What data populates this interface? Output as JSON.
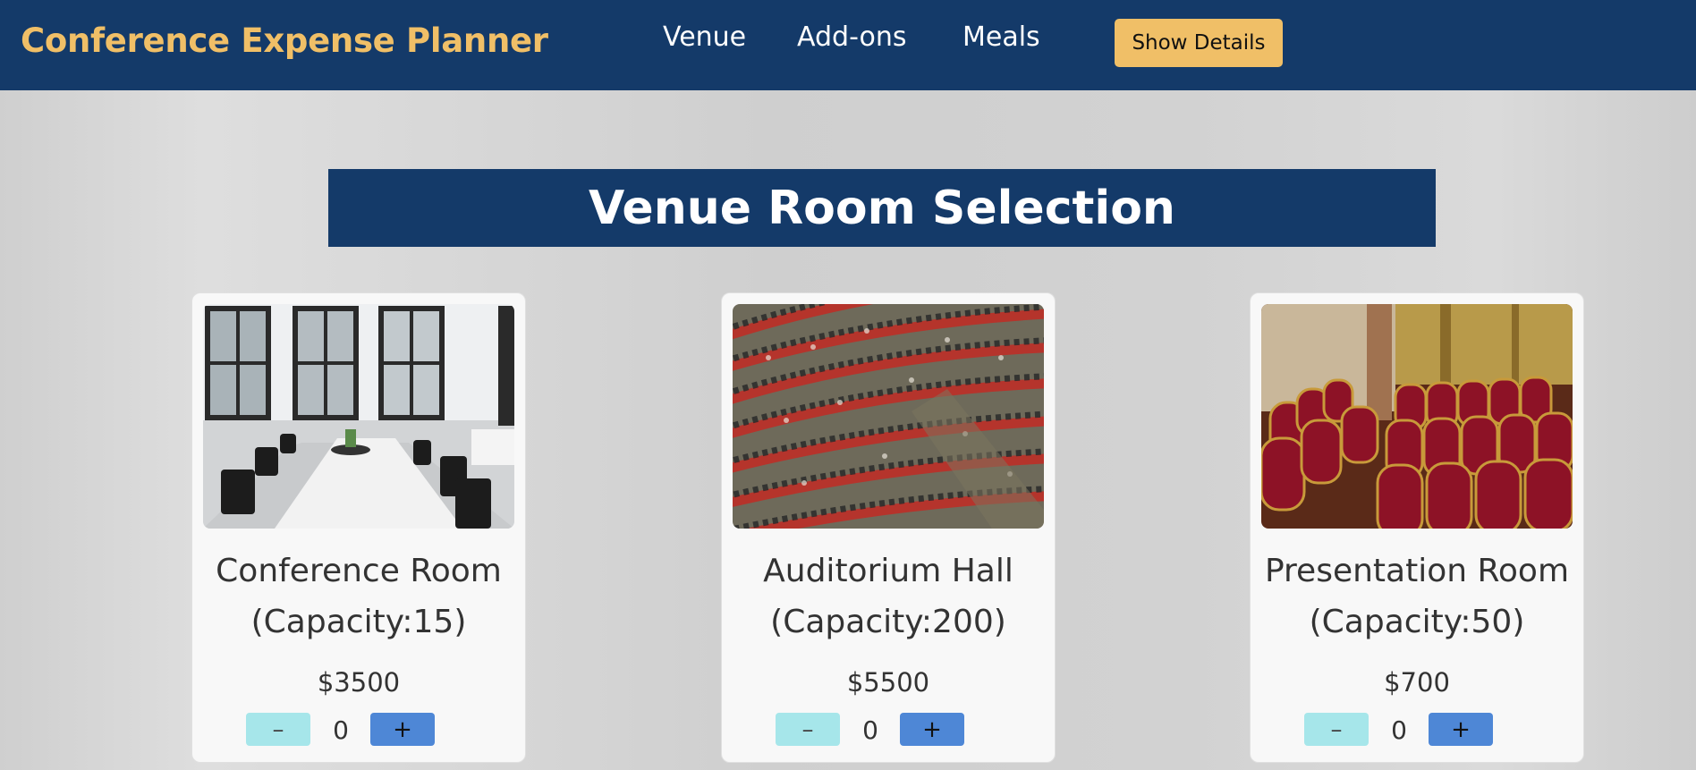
{
  "navbar": {
    "brand": "Conference Expense Planner",
    "links": [
      "Venue",
      "Add-ons",
      "Meals"
    ],
    "show_details_label": "Show Details",
    "brand_color": "#f0bf67",
    "bg_color": "#143a69"
  },
  "section": {
    "title": "Venue Room Selection"
  },
  "rooms": [
    {
      "name": "Conference Room",
      "capacity": "(Capacity:15)",
      "price": "$3500",
      "quantity": "0",
      "image_icon": "conference-room-photo"
    },
    {
      "name": "Auditorium Hall",
      "capacity": "(Capacity:200)",
      "price": "$5500",
      "quantity": "0",
      "image_icon": "auditorium-hall-photo"
    },
    {
      "name": "Presentation Room",
      "capacity": "(Capacity:50)",
      "price": "$700",
      "quantity": "0",
      "image_icon": "presentation-room-photo"
    }
  ],
  "buttons": {
    "minus": "–",
    "plus": "+"
  }
}
